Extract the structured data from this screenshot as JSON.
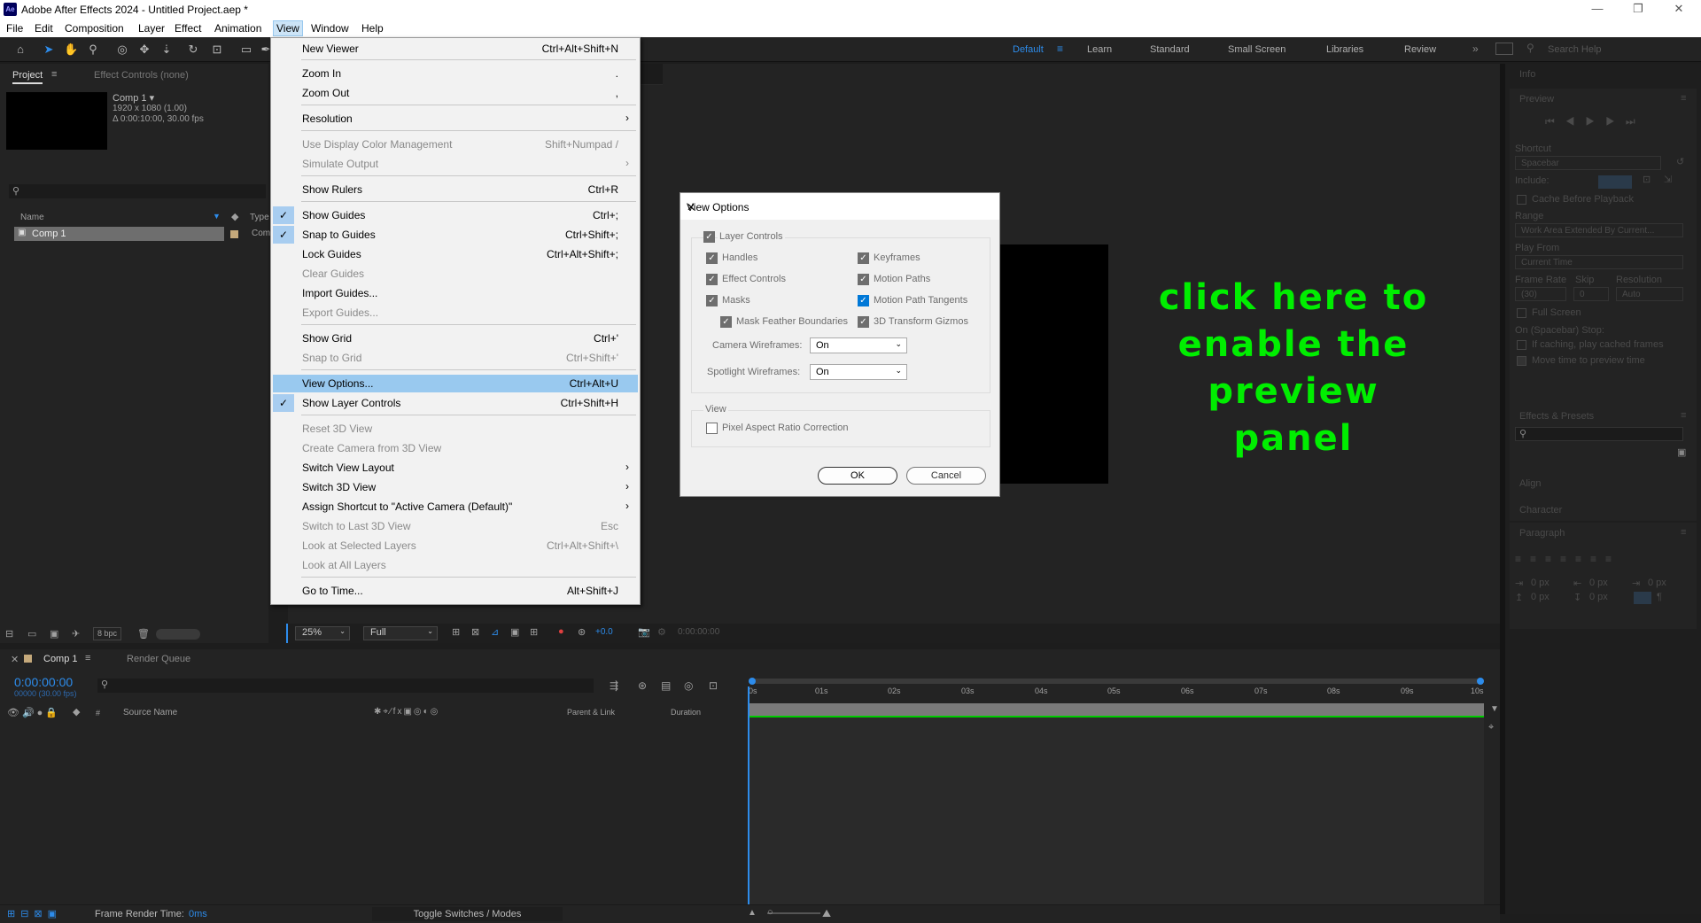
{
  "app": {
    "title": "Adobe After Effects 2024 - Untitled Project.aep *",
    "logo": "Ae",
    "min": "—",
    "max": "❐",
    "close": "✕"
  },
  "menubar": [
    "File",
    "Edit",
    "Composition",
    "Layer",
    "Effect",
    "Animation",
    "View",
    "Window",
    "Help"
  ],
  "workspaces": {
    "items": [
      "Default",
      "Learn",
      "Standard",
      "Small Screen",
      "Libraries",
      "Review"
    ],
    "active": "Default",
    "search_placeholder": "Search Help"
  },
  "project": {
    "tab": "Project",
    "effect_controls": "Effect Controls (none)",
    "comp_name": "Comp 1 ▾",
    "comp_res": "1920 x 1080 (1.00)",
    "comp_dur": "Δ 0:00:10:00, 30.00 fps",
    "col_name": "Name",
    "col_type": "Type",
    "item": "Comp 1",
    "item_type": "Com",
    "bpc": "8 bpc"
  },
  "view_menu": {
    "new_viewer": [
      "New Viewer",
      "Ctrl+Alt+Shift+N"
    ],
    "zoom_in": [
      "Zoom In",
      "."
    ],
    "zoom_out": [
      "Zoom Out",
      ","
    ],
    "resolution": [
      "Resolution",
      ""
    ],
    "display_color": [
      "Use Display Color Management",
      "Shift+Numpad /"
    ],
    "simulate": [
      "Simulate Output",
      ""
    ],
    "rulers": [
      "Show Rulers",
      "Ctrl+R"
    ],
    "guides": [
      "Show Guides",
      "Ctrl+;"
    ],
    "snap_guides": [
      "Snap to Guides",
      "Ctrl+Shift+;"
    ],
    "lock_guides": [
      "Lock Guides",
      "Ctrl+Alt+Shift+;"
    ],
    "clear_guides": [
      "Clear Guides",
      ""
    ],
    "import_guides": [
      "Import Guides...",
      ""
    ],
    "export_guides": [
      "Export Guides...",
      ""
    ],
    "grid": [
      "Show Grid",
      "Ctrl+'"
    ],
    "snap_grid": [
      "Snap to Grid",
      "Ctrl+Shift+'"
    ],
    "view_options": [
      "View Options...",
      "Ctrl+Alt+U"
    ],
    "layer_controls": [
      "Show Layer Controls",
      "Ctrl+Shift+H"
    ],
    "reset3d": [
      "Reset 3D View",
      ""
    ],
    "camera3d": [
      "Create Camera from 3D View",
      ""
    ],
    "switch_layout": [
      "Switch View Layout",
      ""
    ],
    "switch3d": [
      "Switch 3D View",
      ""
    ],
    "assign_shortcut": [
      "Assign Shortcut to \"Active Camera (Default)\"",
      ""
    ],
    "last3d": [
      "Switch to Last 3D View",
      "Esc"
    ],
    "look_selected": [
      "Look at Selected Layers",
      "Ctrl+Alt+Shift+\\"
    ],
    "look_all": [
      "Look at All Layers",
      ""
    ],
    "goto_time": [
      "Go to Time...",
      "Alt+Shift+J"
    ]
  },
  "dialog": {
    "title": "View Options",
    "layer_controls": "Layer Controls",
    "handles": "Handles",
    "keyframes": "Keyframes",
    "effect_controls": "Effect Controls",
    "motion_paths": "Motion Paths",
    "masks": "Masks",
    "motion_path_tangents": "Motion Path Tangents",
    "mask_feather": "Mask Feather Boundaries",
    "transform_gizmos": "3D Transform Gizmos",
    "camera_wireframes": "Camera Wireframes:",
    "camera_value": "On",
    "spotlight_wireframes": "Spotlight Wireframes:",
    "spotlight_value": "On",
    "view": "View",
    "pixel_aspect": "Pixel Aspect Ratio Correction",
    "ok": "OK",
    "cancel": "Cancel"
  },
  "annotation": "click here to enable the preview panel",
  "viewer_footer": {
    "zoom": "25%",
    "quality": "Full",
    "exposure": "+0.0",
    "timecode": "0:00:00:00"
  },
  "timeline": {
    "tab": "Comp 1",
    "render_queue": "Render Queue",
    "timecode": "0:00:00:00",
    "frames": "00000 (30.00 fps)",
    "source_name": "Source Name",
    "parent": "Parent & Link",
    "duration": "Duration",
    "ticks": [
      "0s",
      "01s",
      "02s",
      "03s",
      "04s",
      "05s",
      "06s",
      "07s",
      "08s",
      "09s",
      "10s"
    ],
    "render_time_label": "Frame Render Time:",
    "render_time": "0ms",
    "toggle": "Toggle Switches / Modes"
  },
  "right_panels": {
    "info": "Info",
    "preview": "Preview",
    "shortcut": "Shortcut",
    "spacebar": "Spacebar",
    "include": "Include:",
    "cache": "Cache Before Playback",
    "range": "Range",
    "range_value": "Work Area Extended By Current...",
    "play_from": "Play From",
    "play_from_value": "Current Time",
    "frame_rate": "Frame Rate",
    "skip": "Skip",
    "resolution": "Resolution",
    "fr_value": "(30)",
    "skip_value": "0",
    "res_value": "Auto",
    "full_screen": "Full Screen",
    "stop": "On (Spacebar) Stop:",
    "caching": "If caching, play cached frames",
    "move_time": "Move time to preview time",
    "effects": "Effects & Presets",
    "align": "Align",
    "character": "Character",
    "paragraph": "Paragraph",
    "px1": "0 px",
    "px2": "0 px",
    "px3": "0 px",
    "px4": "0 px",
    "px5": "0 px"
  },
  "colors": {
    "accent": "#2d8ceb",
    "annotation": "#00ee00",
    "highlight": "#99c9ef"
  }
}
